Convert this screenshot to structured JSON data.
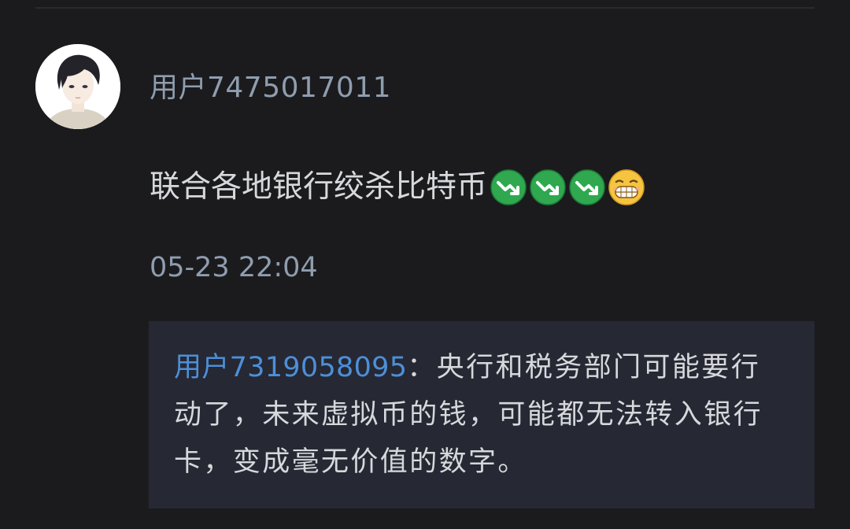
{
  "comment": {
    "username": "用户7475017011",
    "content_text": "联合各地银行绞杀比特币",
    "emojis": [
      "trend-down-emoji",
      "trend-down-emoji",
      "trend-down-emoji",
      "grinning-teeth-emoji"
    ],
    "timestamp": "05-23 22:04"
  },
  "reply": {
    "username": "用户7319058095",
    "separator": "：",
    "text": "央行和税务部门可能要行动了，未来虚拟币的钱，可能都无法转入银行卡，变成毫无价值的数字。"
  },
  "colors": {
    "background": "#1b1b1e",
    "username": "#8f9dae",
    "text": "#d6d8dc",
    "reply_background": "#262833",
    "reply_username": "#4d8fd8",
    "trend_emoji_green": "#2fa84f",
    "grin_emoji_yellow": "#f5c542"
  }
}
